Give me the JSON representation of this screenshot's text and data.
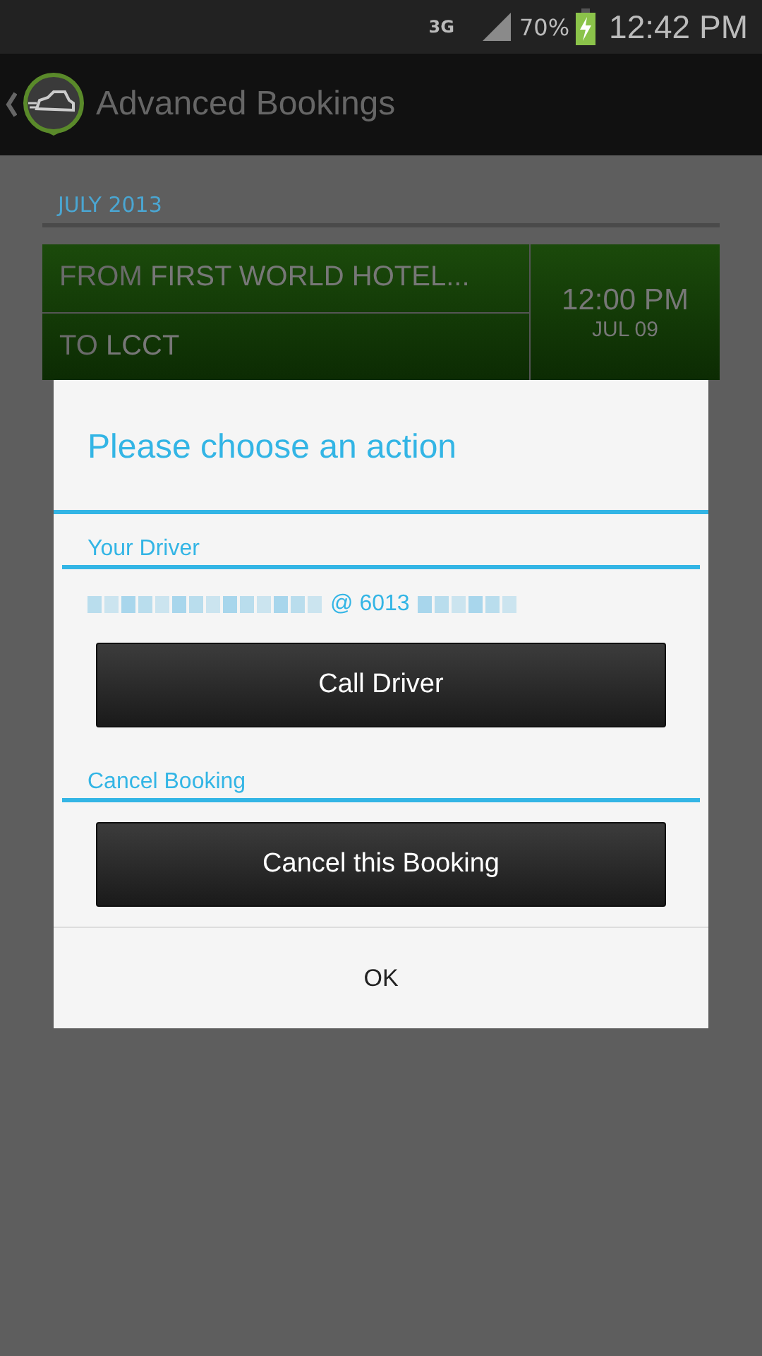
{
  "status_bar": {
    "network": "3G",
    "battery": "70%",
    "time": "12:42 PM"
  },
  "app_bar": {
    "title": "Advanced Bookings"
  },
  "month_header": "JULY 2013",
  "booking": {
    "from_label": "FROM",
    "from": "FIRST WORLD HOTEL...",
    "to_label": "TO",
    "to": "LCCT",
    "time": "12:00 PM",
    "date": "JUL 09"
  },
  "dialog": {
    "title": "Please choose an action",
    "sections": [
      {
        "heading": "Your Driver",
        "kind": "contact",
        "contact": "@ 6013",
        "button": "Call Driver"
      },
      {
        "heading": "Cancel Booking",
        "kind": "action",
        "button": "Cancel this Booking"
      }
    ],
    "ok": "OK"
  }
}
